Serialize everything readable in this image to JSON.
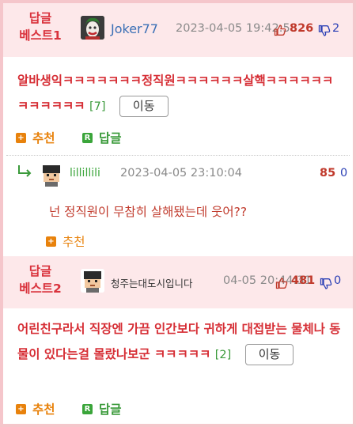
{
  "best1": {
    "label_line1": "답글",
    "label_line2": "베스트1",
    "nickname": "Joker77",
    "datetime": "2023-04-05 19:42:58",
    "upvotes": "826",
    "downvotes": "2",
    "body": "알바생익ㅋㅋㅋㅋㅋㅋㅋ정직원ㅋㅋㅋㅋㅋㅋ살핵ㅋㅋㅋㅋㅋㅋㅋㅋㅋㅋㅋㅋ",
    "reply_count": "[7]",
    "move_label": "이동",
    "recommend_label": "추천",
    "reply_label": "답글"
  },
  "reply1": {
    "nickname": "lillillili",
    "datetime": "2023-04-05 23:10:04",
    "upvotes": "85",
    "downvotes": "0",
    "body": "넌 정직원이 무참히 살해됐는데 웃어??",
    "recommend_label": "추천"
  },
  "best2": {
    "label_line1": "답글",
    "label_line2": "베스트2",
    "nickname": "청주는대도시입니다",
    "datetime": "04-05 20:44:31",
    "upvotes": "481",
    "downvotes": "0",
    "body": "어린친구라서 직장엔 가끔 인간보다 귀하게 대접받는 물체나 동물이 있다는걸 몰랐나보군 ㅋㅋㅋㅋㅋ",
    "reply_count": "[2]",
    "move_label": "이동",
    "recommend_label": "추천",
    "reply_label": "답글"
  },
  "colors": {
    "accent_red": "#d62e35",
    "header_pink": "#fde8ea",
    "border_pink": "#f5c6cb",
    "orange": "#e8820c",
    "green": "#3a9a3a",
    "blue_nick": "#3a6fb5"
  }
}
